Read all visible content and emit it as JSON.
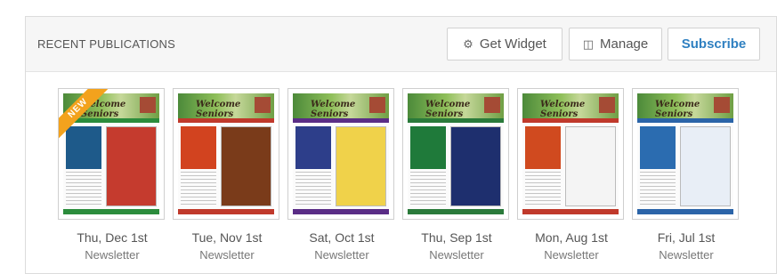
{
  "header": {
    "title": "RECENT PUBLICATIONS",
    "get_widget_label": "Get Widget",
    "manage_label": "Manage",
    "subscribe_label": "Subscribe",
    "get_widget_icon": "gear-icon",
    "manage_icon": "document-icon"
  },
  "publications": [
    {
      "date": "Thu, Dec 1st",
      "type": "Newsletter",
      "badge": "NEW",
      "masthead": "Welcome Seniors",
      "accent": "#2b8c3c",
      "left_panel": "#1e5a8a",
      "right_panel": "#c53b2e"
    },
    {
      "date": "Tue, Nov 1st",
      "type": "Newsletter",
      "badge": "",
      "masthead": "Welcome Seniors",
      "accent": "#c0392b",
      "left_panel": "#d2431f",
      "right_panel": "#7a3b1a"
    },
    {
      "date": "Sat, Oct 1st",
      "type": "Newsletter",
      "badge": "",
      "masthead": "Welcome Seniors",
      "accent": "#5a2d86",
      "left_panel": "#2d3e8a",
      "right_panel": "#f0d24a"
    },
    {
      "date": "Thu, Sep 1st",
      "type": "Newsletter",
      "badge": "",
      "masthead": "Welcome Seniors",
      "accent": "#2a7a3a",
      "left_panel": "#1f7a3a",
      "right_panel": "#1e2f6e"
    },
    {
      "date": "Mon, Aug 1st",
      "type": "Newsletter",
      "badge": "",
      "masthead": "Welcome Seniors",
      "accent": "#c0392b",
      "left_panel": "#d04a1f",
      "right_panel": "#f4f4f4"
    },
    {
      "date": "Fri, Jul 1st",
      "type": "Newsletter",
      "badge": "",
      "masthead": "Welcome Seniors",
      "accent": "#2b64a8",
      "left_panel": "#2b6cb0",
      "right_panel": "#e8eef6"
    }
  ]
}
